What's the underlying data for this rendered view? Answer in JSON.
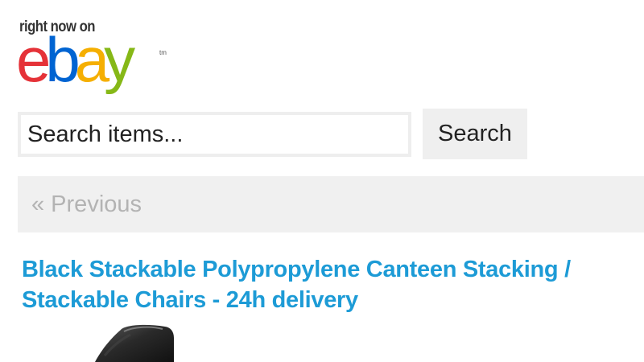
{
  "brand": {
    "tagline": "right now on",
    "logo_letters": [
      {
        "char": "e",
        "color": "#e53238"
      },
      {
        "char": "b",
        "color": "#0064d2"
      },
      {
        "char": "a",
        "color": "#f5af02"
      },
      {
        "char": "y",
        "color": "#86b817"
      }
    ],
    "trademark": "tm"
  },
  "search": {
    "placeholder": "Search items...",
    "button_label": "Search"
  },
  "pager": {
    "previous_label": "« Previous"
  },
  "listing": {
    "title": "Black Stackable Polypropylene Canteen Stacking / Stackable Chairs - 24h delivery",
    "link_color": "#1d9bd6",
    "image_subject": "black-stackable-chair"
  }
}
